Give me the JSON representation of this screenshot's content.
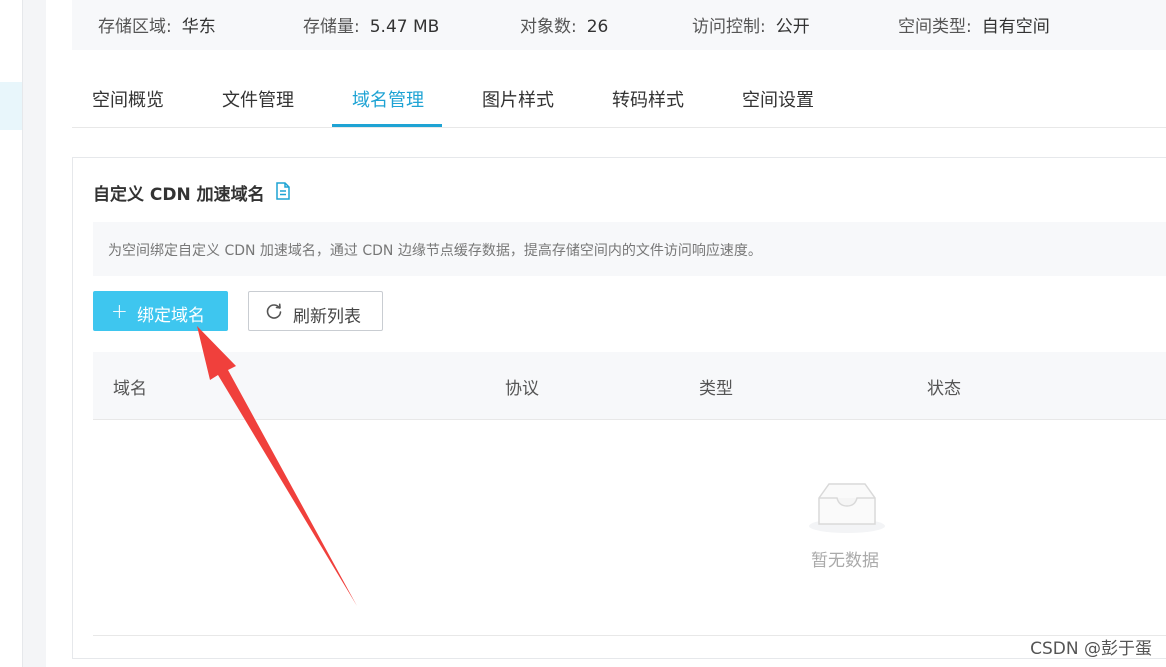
{
  "stats": [
    {
      "label": "存储区域:",
      "value": "华东"
    },
    {
      "label": "存储量:",
      "value": "5.47 MB"
    },
    {
      "label": "对象数:",
      "value": "26"
    },
    {
      "label": "访问控制:",
      "value": "公开"
    },
    {
      "label": "空间类型:",
      "value": "自有空间"
    }
  ],
  "tabs": [
    {
      "label": "空间概览"
    },
    {
      "label": "文件管理"
    },
    {
      "label": "域名管理"
    },
    {
      "label": "图片样式"
    },
    {
      "label": "转码样式"
    },
    {
      "label": "空间设置"
    }
  ],
  "active_tab": "域名管理",
  "section": {
    "title": "自定义 CDN 加速域名",
    "title_icon": "document-icon",
    "notice": "为空间绑定自定义 CDN 加速域名，通过 CDN 边缘节点缓存数据，提高存储空间内的文件访问响应速度。"
  },
  "buttons": {
    "bind_domain": {
      "icon": "plus-icon",
      "label": "绑定域名"
    },
    "refresh_list": {
      "icon": "refresh-icon",
      "label": "刷新列表"
    }
  },
  "table": {
    "columns": [
      "域名",
      "协议",
      "类型",
      "状态"
    ],
    "rows": [],
    "empty_text": "暂无数据",
    "empty_icon": "empty-inbox-icon"
  },
  "annotation": {
    "icon": "red-arrow",
    "color": "#f0403c"
  },
  "watermark": "CSDN @彭于蛋",
  "colors": {
    "accent": "#1ea3d4",
    "primary_button": "#3ec6ef",
    "arrow": "#f0403c"
  }
}
